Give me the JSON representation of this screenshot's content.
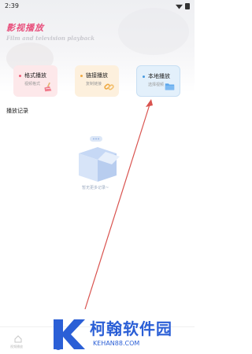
{
  "status_bar": {
    "time": "2:39"
  },
  "header": {
    "title": "影视播放",
    "subtitle": "Film and television playback"
  },
  "cards": [
    {
      "label": "格式播放",
      "desc": "视频格式",
      "icon": "broom-icon",
      "accent": "#ef5f78"
    },
    {
      "label": "链接播放",
      "desc": "复制链接",
      "icon": "link-icon",
      "accent": "#efaa44"
    },
    {
      "label": "本地播放",
      "desc": "选择视频",
      "icon": "folder-icon",
      "accent": "#4a9be0"
    }
  ],
  "history": {
    "title": "播放记录",
    "empty_text": "暂无更多记录~"
  },
  "tabbar": {
    "home_label": "视频播放"
  },
  "watermark": {
    "name": "柯翰软件园",
    "url": "KEHAN88.COM"
  }
}
